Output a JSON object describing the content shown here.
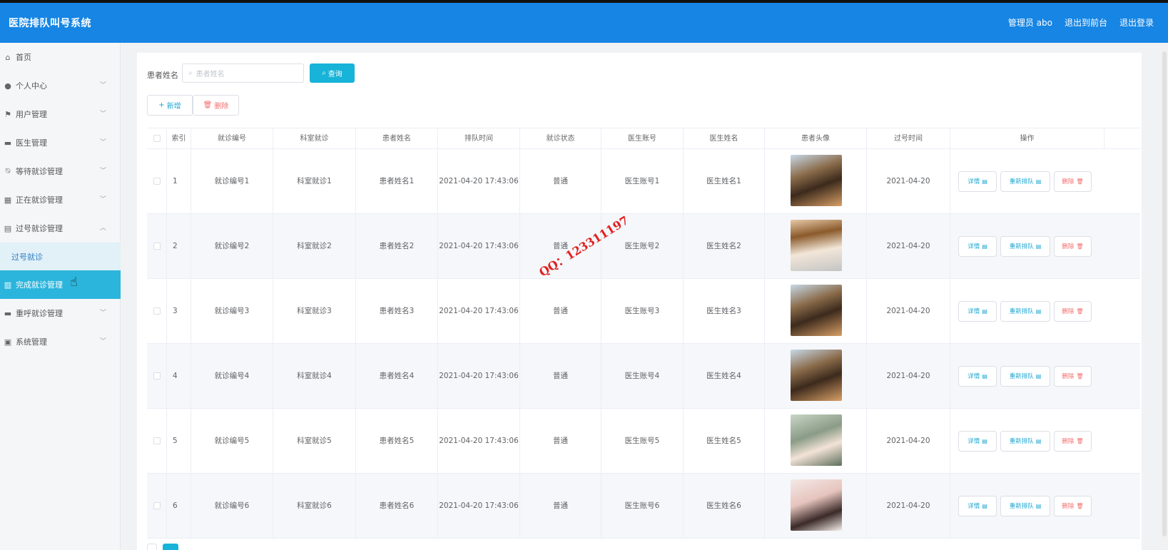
{
  "header": {
    "title": "医院排队叫号系统",
    "admin": "管理员 abo",
    "back_front": "退出到前台",
    "logout": "退出登录"
  },
  "sidebar": {
    "items": [
      {
        "label": "首页",
        "icon": "home-icon",
        "expanded": false
      },
      {
        "label": "个人中心",
        "icon": "user-icon"
      },
      {
        "label": "用户管理",
        "icon": "flag-icon"
      },
      {
        "label": "医生管理",
        "icon": "monitor-icon"
      },
      {
        "label": "等待就诊管理",
        "icon": "bell-off-icon"
      },
      {
        "label": "正在就诊管理",
        "icon": "grid-icon"
      },
      {
        "label": "过号就诊管理",
        "icon": "clipboard-icon"
      },
      {
        "label": "过号就诊",
        "icon": ""
      },
      {
        "label": "完成就诊管理",
        "icon": "chart-icon"
      },
      {
        "label": "重呼就诊管理",
        "icon": "chat-icon"
      },
      {
        "label": "系统管理",
        "icon": "checklist-icon"
      }
    ]
  },
  "search": {
    "label": "患者姓名",
    "placeholder": "患者姓名",
    "button": "查询"
  },
  "toolbar": {
    "add": "新增",
    "delete": "删除"
  },
  "table": {
    "columns": [
      "索引",
      "就诊编号",
      "科室就诊",
      "患者姓名",
      "排队时间",
      "就诊状态",
      "医生账号",
      "医生姓名",
      "患者头像",
      "过号时间",
      "操作"
    ],
    "rows": [
      {
        "index": "1",
        "visit_no": "就诊编号1",
        "dept": "科室就诊1",
        "patient": "患者姓名1",
        "queue_time": "2021-04-20 17:43:06",
        "status": "普通",
        "doc_acct": "医生账号1",
        "doc_name": "医生姓名1",
        "pass_time": "2021-04-20"
      },
      {
        "index": "2",
        "visit_no": "就诊编号2",
        "dept": "科室就诊2",
        "patient": "患者姓名2",
        "queue_time": "2021-04-20 17:43:06",
        "status": "普通",
        "doc_acct": "医生账号2",
        "doc_name": "医生姓名2",
        "pass_time": "2021-04-20"
      },
      {
        "index": "3",
        "visit_no": "就诊编号3",
        "dept": "科室就诊3",
        "patient": "患者姓名3",
        "queue_time": "2021-04-20 17:43:06",
        "status": "普通",
        "doc_acct": "医生账号3",
        "doc_name": "医生姓名3",
        "pass_time": "2021-04-20"
      },
      {
        "index": "4",
        "visit_no": "就诊编号4",
        "dept": "科室就诊4",
        "patient": "患者姓名4",
        "queue_time": "2021-04-20 17:43:06",
        "status": "普通",
        "doc_acct": "医生账号4",
        "doc_name": "医生姓名4",
        "pass_time": "2021-04-20"
      },
      {
        "index": "5",
        "visit_no": "就诊编号5",
        "dept": "科室就诊5",
        "patient": "患者姓名5",
        "queue_time": "2021-04-20 17:43:06",
        "status": "普通",
        "doc_acct": "医生账号5",
        "doc_name": "医生姓名5",
        "pass_time": "2021-04-20"
      },
      {
        "index": "6",
        "visit_no": "就诊编号6",
        "dept": "科室就诊6",
        "patient": "患者姓名6",
        "queue_time": "2021-04-20 17:43:06",
        "status": "普通",
        "doc_acct": "医生账号6",
        "doc_name": "医生姓名6",
        "pass_time": "2021-04-20"
      }
    ],
    "ops": {
      "detail": "详情",
      "requeue": "重新排队",
      "delete": "删除"
    }
  },
  "watermark": "QQ：123311197",
  "colors": {
    "header": "#1685e4",
    "accent": "#17b3d8",
    "danger": "#f56c6c",
    "active_menu": "#2bb5dc"
  }
}
